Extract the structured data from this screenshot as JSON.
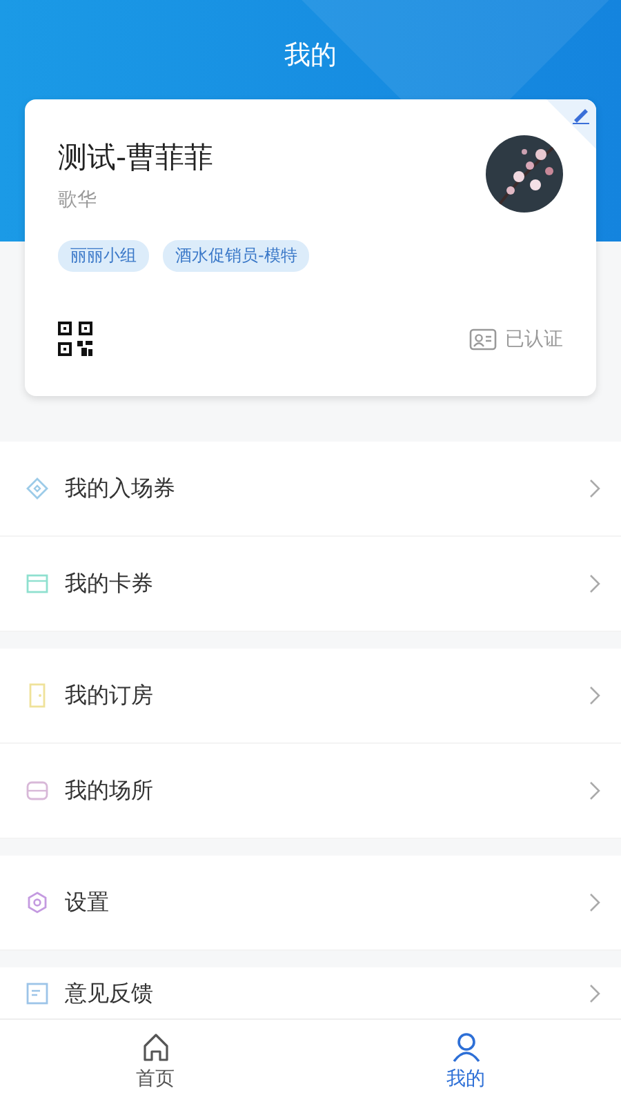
{
  "header": {
    "title": "我的"
  },
  "profile": {
    "name": "测试-曹菲菲",
    "company": "歌华",
    "tags": [
      "丽丽小组",
      "酒水促销员-模特"
    ],
    "verified": "已认证"
  },
  "groups": [
    {
      "items": [
        {
          "kind": "ticket",
          "label": "我的入场券"
        },
        {
          "kind": "card",
          "label": "我的卡券"
        }
      ]
    },
    {
      "items": [
        {
          "kind": "room",
          "label": "我的订房"
        },
        {
          "kind": "venue",
          "label": "我的场所"
        }
      ]
    },
    {
      "items": [
        {
          "kind": "settings",
          "label": "设置"
        }
      ]
    },
    {
      "items": [
        {
          "kind": "feedback",
          "label": "意见反馈"
        }
      ]
    }
  ],
  "tabs": [
    {
      "kind": "home",
      "label": "首页",
      "selected": false
    },
    {
      "kind": "user",
      "label": "我的",
      "selected": true
    }
  ]
}
